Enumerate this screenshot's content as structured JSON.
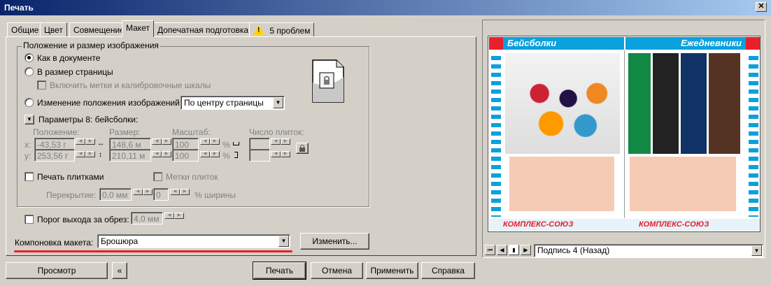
{
  "window": {
    "title": "Печать",
    "close": "✕"
  },
  "tabs": [
    {
      "label": "Общие"
    },
    {
      "label": "Цвет"
    },
    {
      "label": "Совмещение"
    },
    {
      "label": "Макет"
    },
    {
      "label": "Допечатная подготовка"
    },
    {
      "label": "5 проблем"
    }
  ],
  "position_group": {
    "legend": "Положение и размер изображения",
    "as_in_document": "Как в документе",
    "fit_to_page": "В размер страницы",
    "include_marks": "Включить метки и калибровочные шкалы",
    "reposition": "Изменение положения изображений на:",
    "reposition_value": "По центру страницы",
    "params": "Параметры 8: бейсболки:",
    "col_position": "Положение:",
    "col_size": "Размер:",
    "col_scale": "Масштаб:",
    "col_tiles": "Число плиток:",
    "x_label": "x:",
    "y_label": "y:",
    "x_value": "-43,53 г",
    "y_value": "253,56 г",
    "w_value": "148,6 м",
    "h_value": "210,11 м",
    "scale_x": "100",
    "scale_y": "100",
    "pct": "%",
    "print_tiles": "Печать плитками",
    "tile_marks": "Метки плиток",
    "overlap_label": "Перекрытие:",
    "overlap_value": "0,0 мм",
    "width_value": "0",
    "width_unit": "% ширины"
  },
  "bleed": {
    "label": "Порог выхода за обрез:",
    "value": "4,0 мм"
  },
  "layout": {
    "label": "Компоновка макета:",
    "value": "Брошюра",
    "edit": "Изменить..."
  },
  "buttons": {
    "preview": "Просмотр",
    "print": "Печать",
    "cancel": "Отмена",
    "apply": "Применить",
    "help": "Справка",
    "collapse": "«"
  },
  "preview": {
    "left_title": "Бейсболки",
    "right_title": "Ежедневники",
    "brand": "КОМПЛЕКС-СОЮЗ",
    "page_select": "Подпись 4 (Назад)"
  },
  "colors": {
    "accent_red": "#e8202a",
    "accent_blue": "#0aa1dd",
    "title_blue": "#0a246a"
  }
}
